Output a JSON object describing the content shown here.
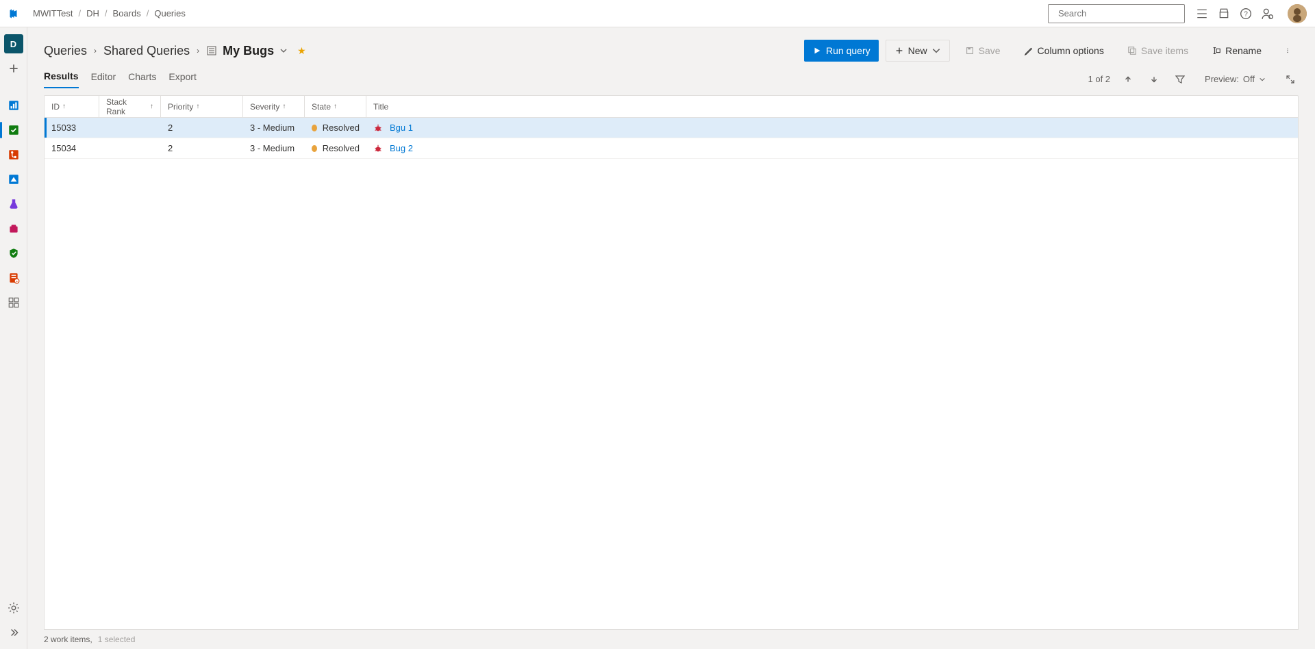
{
  "top": {
    "crumbs": [
      "MWITTest",
      "DH",
      "Boards",
      "Queries"
    ],
    "search_placeholder": "Search"
  },
  "leftnav": {
    "project_initial": "D"
  },
  "header": {
    "breadcrumb": [
      "Queries",
      "Shared Queries"
    ],
    "query_name": "My Bugs",
    "actions": {
      "run_query": "Run query",
      "new": "New",
      "save": "Save",
      "column_options": "Column options",
      "save_items": "Save items",
      "rename": "Rename"
    }
  },
  "tabs": {
    "items": [
      "Results",
      "Editor",
      "Charts",
      "Export"
    ],
    "counter": "1 of 2",
    "preview_label": "Preview:",
    "preview_value": "Off"
  },
  "columns": {
    "id": "ID",
    "stack_rank": "Stack Rank",
    "priority": "Priority",
    "severity": "Severity",
    "state": "State",
    "title": "Title"
  },
  "rows": [
    {
      "id": "15033",
      "stack_rank": "",
      "priority": "2",
      "severity": "3 - Medium",
      "state": "Resolved",
      "title": "Bgu 1",
      "selected": true
    },
    {
      "id": "15034",
      "stack_rank": "",
      "priority": "2",
      "severity": "3 - Medium",
      "state": "Resolved",
      "title": "Bug 2",
      "selected": false
    }
  ],
  "status": {
    "items": "2 work items,",
    "selected": "1 selected"
  }
}
